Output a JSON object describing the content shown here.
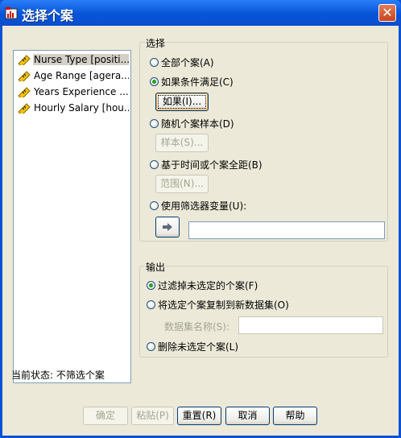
{
  "window": {
    "title": "选择个案",
    "close_label": "✕"
  },
  "variables": [
    {
      "label": "Nurse Type [positi..."
    },
    {
      "label": "Age Range [agera..."
    },
    {
      "label": "Years Experience ..."
    },
    {
      "label": "Hourly Salary [hou..."
    }
  ],
  "select_group": {
    "title": "选择",
    "all_cases": "全部个案(A)",
    "if_condition": "如果条件满足(C)",
    "if_button": "如果(I)...",
    "random_sample": "随机个案样本(D)",
    "sample_button": "样本(S)...",
    "time_range": "基于时间或个案全距(B)",
    "range_button": "范围(N)...",
    "filter_var": "使用筛选器变量(U):",
    "filter_value": ""
  },
  "output_group": {
    "title": "输出",
    "filter_out": "过滤掉未选定的个案(F)",
    "copy_to_new": "将选定个案复制到新数据集(O)",
    "dataset_name_label": "数据集名称(S):",
    "dataset_name_value": "",
    "delete_unselected": "删除未选定个案(L)"
  },
  "status_text": "当前状态: 不筛选个案",
  "buttons": {
    "ok": "确定",
    "paste": "粘贴(P)",
    "reset": "重置(R)",
    "cancel": "取消",
    "help": "帮助"
  }
}
